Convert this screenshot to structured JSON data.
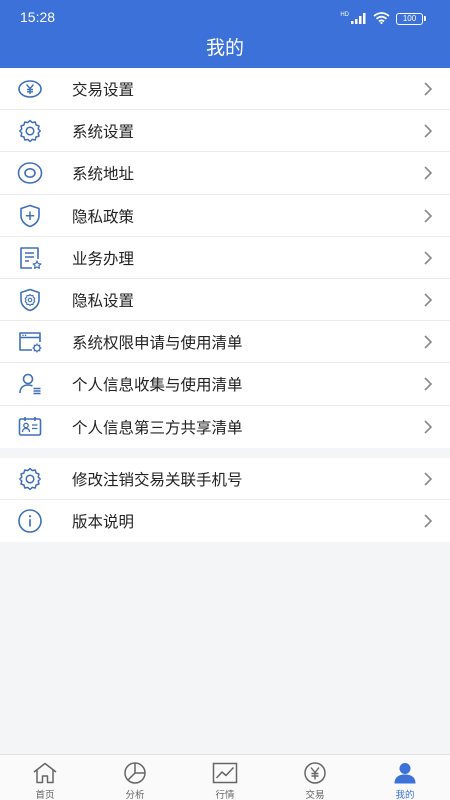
{
  "status_bar": {
    "time": "15:28",
    "network": "HD",
    "battery": "100"
  },
  "header": {
    "title": "我的"
  },
  "menu_group_1": [
    {
      "label": "交易设置",
      "icon": "yen-circle-icon"
    },
    {
      "label": "系统设置",
      "icon": "gear-icon"
    },
    {
      "label": "系统地址",
      "icon": "location-icon"
    },
    {
      "label": "隐私政策",
      "icon": "shield-plus-icon"
    },
    {
      "label": "业务办理",
      "icon": "document-star-icon"
    },
    {
      "label": "隐私设置",
      "icon": "shield-gear-icon"
    },
    {
      "label": "系统权限申请与使用清单",
      "icon": "window-gear-icon"
    },
    {
      "label": "个人信息收集与使用清单",
      "icon": "user-list-icon"
    },
    {
      "label": "个人信息第三方共享清单",
      "icon": "id-card-icon"
    }
  ],
  "menu_group_2": [
    {
      "label": "修改注销交易关联手机号",
      "icon": "gear-icon"
    },
    {
      "label": "版本说明",
      "icon": "info-circle-icon"
    }
  ],
  "tabbar": [
    {
      "label": "首页",
      "icon": "home-icon",
      "active": false
    },
    {
      "label": "分析",
      "icon": "pie-chart-icon",
      "active": false
    },
    {
      "label": "行情",
      "icon": "line-chart-icon",
      "active": false
    },
    {
      "label": "交易",
      "icon": "yen-circle-icon",
      "active": false
    },
    {
      "label": "我的",
      "icon": "user-icon",
      "active": true
    }
  ],
  "colors": {
    "accent": "#3b71d8",
    "icon_blue": "#3e6fb8",
    "text": "#222222",
    "background": "#f4f5f7"
  }
}
